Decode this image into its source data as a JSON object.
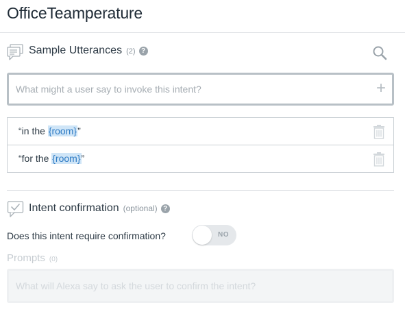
{
  "intent": {
    "name": "OfficeTeamperature"
  },
  "sample_utterances": {
    "title": "Sample Utterances",
    "count": "(2)",
    "help": "?",
    "placeholder": "What might a user say to invoke this intent?",
    "add_symbol": "+",
    "items": [
      {
        "prefix": "“in the ",
        "slot": "{room}",
        "suffix": "”"
      },
      {
        "prefix": "“for the ",
        "slot": "{room}",
        "suffix": "”"
      }
    ]
  },
  "intent_confirmation": {
    "title": "Intent confirmation",
    "optional": "(optional)",
    "help": "?",
    "question": "Does this intent require confirmation?",
    "toggle_label": "NO",
    "toggle_on": false
  },
  "prompts": {
    "title": "Prompts",
    "count": "(0)",
    "placeholder": "What will Alexa say to ask the user to confirm the intent?"
  },
  "colors": {
    "slot_bg": "#cfe5f7",
    "slot_text": "#2e7bc4",
    "border": "#c9cfd4"
  }
}
